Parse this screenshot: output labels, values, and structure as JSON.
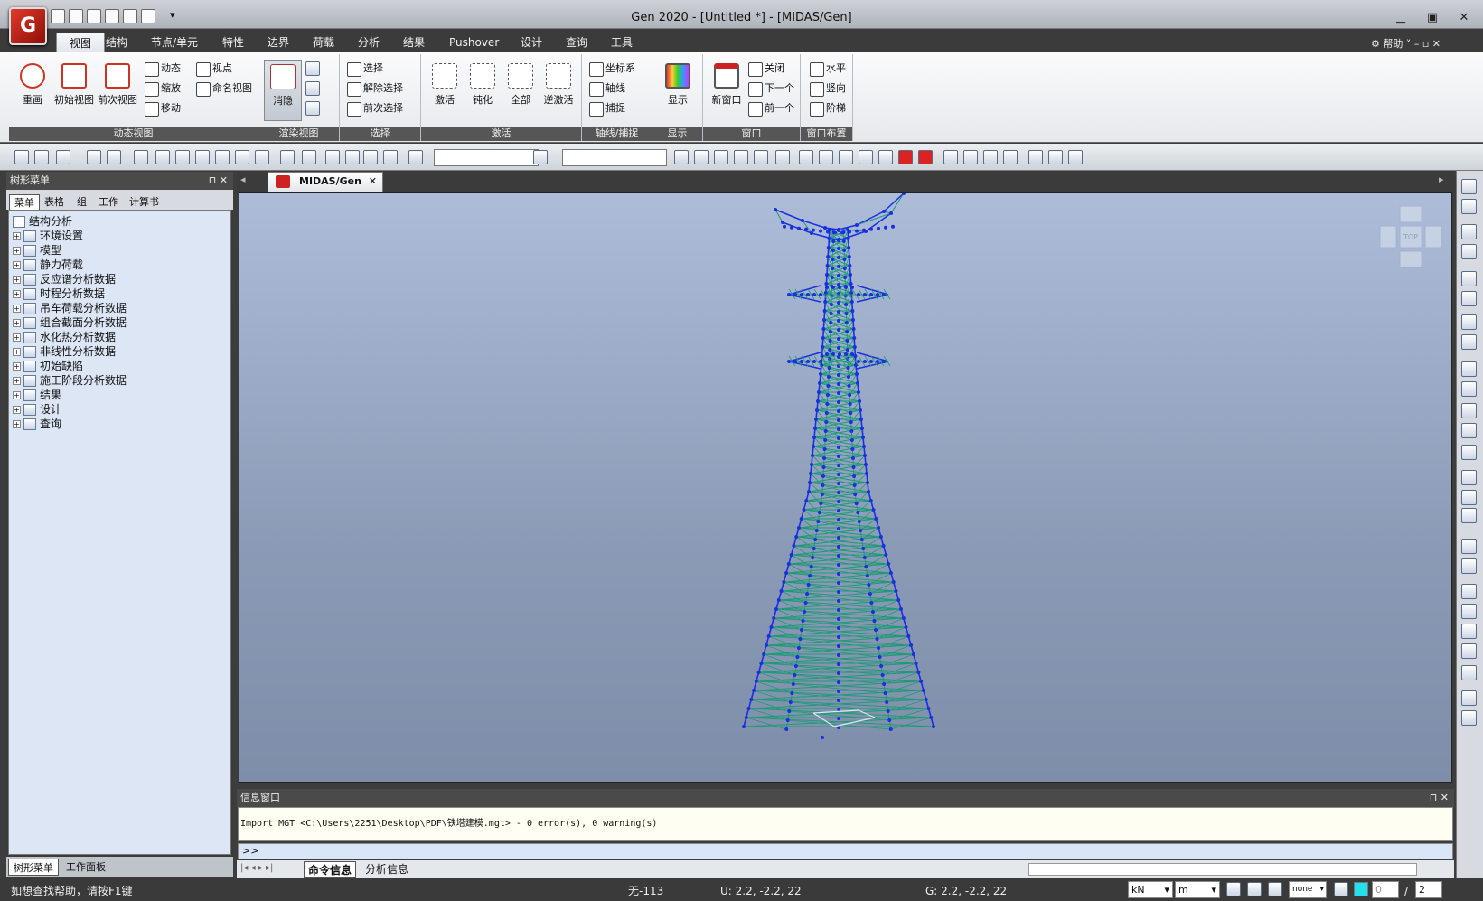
{
  "app": {
    "icon_label": "G",
    "window_title": "Gen 2020 - [Untitled *] - [MIDAS/Gen]",
    "help_label": "帮助"
  },
  "menu": [
    "视图",
    "结构",
    "节点/单元",
    "特性",
    "边界",
    "荷载",
    "分析",
    "结果",
    "Pushover",
    "设计",
    "查询",
    "工具"
  ],
  "ribbon": {
    "groups": {
      "dynamic_view": "动态视图",
      "render_view": "渲染视图",
      "select": "选择",
      "activate": "激活",
      "axis_snap": "轴线/捕捉",
      "display": "显示",
      "window": "窗口",
      "window_layout": "窗口布置"
    },
    "btn_redraw": "重画",
    "btn_initial_view": "初始视图",
    "btn_prev_view": "前次视图",
    "btn_dynamic": "动态",
    "btn_zoom": "缩放",
    "btn_move": "移动",
    "btn_viewpoint": "视点",
    "btn_named_view": "命名视图",
    "btn_hide": "消隐",
    "btn_select": "选择",
    "btn_deselect": "解除选择",
    "btn_prev_select": "前次选择",
    "btn_activate": "激活",
    "btn_deactivate": "钝化",
    "btn_all": "全部",
    "btn_inverse": "逆激活",
    "btn_coord": "坐标系",
    "btn_axis": "轴线",
    "btn_snap": "捕捉",
    "btn_display": "显示",
    "btn_new_window": "新窗口",
    "btn_close": "关闭",
    "btn_next": "下一个",
    "btn_prev": "前一个",
    "btn_horizontal": "水平",
    "btn_vertical": "竖向",
    "btn_cascade": "阶梯"
  },
  "left_panel": {
    "title": "树形菜单",
    "tabs": [
      "菜单",
      "表格",
      "组",
      "工作",
      "计算书"
    ],
    "root": "结构分析",
    "tree": [
      "环境设置",
      "模型",
      "静力荷载",
      "反应谱分析数据",
      "时程分析数据",
      "吊车荷载分析数据",
      "组合截面分析数据",
      "水化热分析数据",
      "非线性分析数据",
      "初始缺陷",
      "施工阶段分析数据",
      "结果",
      "设计",
      "查询"
    ],
    "bottom_tabs": [
      "树形菜单",
      "工作面板"
    ]
  },
  "document": {
    "tab_label": "MIDAS/Gen",
    "cube_label": "TOP"
  },
  "info": {
    "title": "信息窗口",
    "message": "Import MGT <C:\\Users\\2251\\Desktop\\PDF\\铁塔建模.mgt> - 0 error(s), 0 warning(s)",
    "prompt": ">>",
    "tabs": [
      "命令信息",
      "分析信息"
    ]
  },
  "status": {
    "help": "如想查找帮助，请按F1键",
    "selection": "无-113",
    "u_coord": "U: 2.2, -2.2, 22",
    "g_coord": "G: 2.2, -2.2, 22",
    "force_unit": "kN",
    "length_unit": "m",
    "mode": "none",
    "page_current": "0",
    "page_sep": "/",
    "page_total": "2"
  },
  "colors": {
    "tower_nodes": "#1a2fe0",
    "tower_members": "#1f9a78",
    "viewport_top": "#adbcd8",
    "viewport_bottom": "#7e8ea9"
  }
}
